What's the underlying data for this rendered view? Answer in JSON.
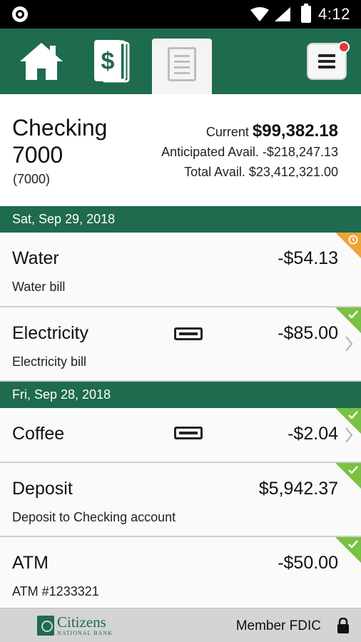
{
  "status_bar": {
    "time": "4:12"
  },
  "nav": {
    "tabs": [
      "home-icon",
      "dollar-accounts-icon",
      "document-icon"
    ],
    "menu_icon": "hamburger-menu-icon",
    "notification_color": "#e53935"
  },
  "account": {
    "name": "Checking 7000",
    "number": "(7000)",
    "current_label": "Current ",
    "current_value": "$99,382.18",
    "anticipated": "Anticipated Avail. -$218,247.13",
    "total": "Total Avail. $23,412,321.00"
  },
  "groups": [
    {
      "date": "Sat, Sep 29, 2018",
      "transactions": [
        {
          "title": "Water",
          "description": "Water bill",
          "amount": "-$54.13",
          "status": "pending"
        },
        {
          "title": "Electricity",
          "description": "Electricity bill",
          "amount": "-$85.00",
          "status": "cleared"
        }
      ]
    },
    {
      "date": "Fri, Sep 28, 2018",
      "transactions": [
        {
          "title": "Coffee",
          "description": "",
          "amount": "-$2.04",
          "status": "cleared"
        },
        {
          "title": "Deposit",
          "description": "Deposit to Checking account",
          "amount": "$5,942.37",
          "status": "cleared"
        },
        {
          "title": "ATM",
          "description": "ATM #1233321",
          "amount": "-$50.00",
          "status": "cleared"
        }
      ]
    }
  ],
  "footer": {
    "logo_line1": "Citizens",
    "logo_line2": "NATIONAL BANK",
    "fdic": "Member FDIC"
  },
  "colors": {
    "brand_green": "#1e6b4d",
    "cleared_green": "#7bc142",
    "pending_orange": "#f0a33a"
  }
}
